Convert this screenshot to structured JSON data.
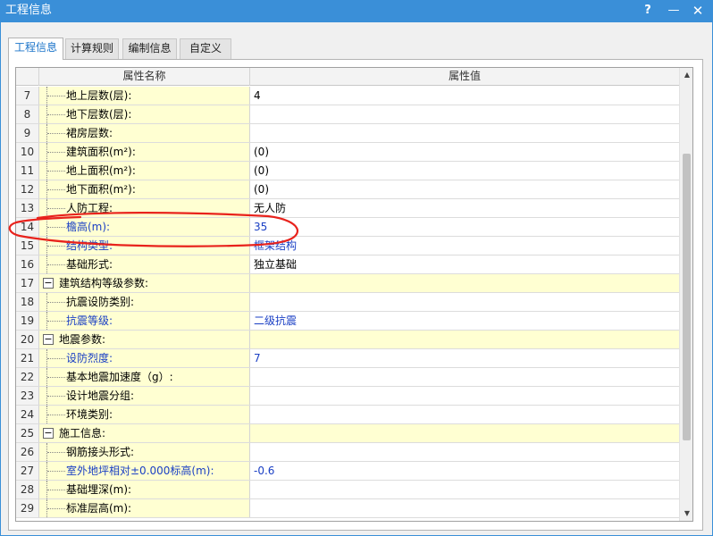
{
  "window": {
    "title": "工程信息",
    "help_label": "?",
    "minimize_label": "—",
    "close_label": "✕"
  },
  "tabs": [
    {
      "label": "工程信息",
      "active": true
    },
    {
      "label": "计算规则",
      "active": false
    },
    {
      "label": "编制信息",
      "active": false
    },
    {
      "label": "自定义",
      "active": false
    }
  ],
  "grid": {
    "columns": {
      "name": "属性名称",
      "value": "属性值"
    },
    "rows": [
      {
        "index": "7",
        "name": "地上层数(层):",
        "value": "4",
        "group": false,
        "blue": false
      },
      {
        "index": "8",
        "name": "地下层数(层):",
        "value": "",
        "group": false,
        "blue": false
      },
      {
        "index": "9",
        "name": "裙房层数:",
        "value": "",
        "group": false,
        "blue": false
      },
      {
        "index": "10",
        "name": "建筑面积(m²):",
        "value": "(0)",
        "group": false,
        "blue": false
      },
      {
        "index": "11",
        "name": "地上面积(m²):",
        "value": "(0)",
        "group": false,
        "blue": false
      },
      {
        "index": "12",
        "name": "地下面积(m²):",
        "value": "(0)",
        "group": false,
        "blue": false
      },
      {
        "index": "13",
        "name": "人防工程:",
        "value": "无人防",
        "group": false,
        "blue": false
      },
      {
        "index": "14",
        "name": "檐高(m):",
        "value": "35",
        "group": false,
        "blue": true
      },
      {
        "index": "15",
        "name": "结构类型:",
        "value": "框架结构",
        "group": false,
        "blue": true
      },
      {
        "index": "16",
        "name": "基础形式:",
        "value": "独立基础",
        "group": false,
        "blue": false
      },
      {
        "index": "17",
        "name": "建筑结构等级参数:",
        "value": "",
        "group": true,
        "blue": false
      },
      {
        "index": "18",
        "name": "抗震设防类别:",
        "value": "",
        "group": false,
        "blue": false
      },
      {
        "index": "19",
        "name": "抗震等级:",
        "value": "二级抗震",
        "group": false,
        "blue": true
      },
      {
        "index": "20",
        "name": "地震参数:",
        "value": "",
        "group": true,
        "blue": false
      },
      {
        "index": "21",
        "name": "设防烈度:",
        "value": "7",
        "group": false,
        "blue": true
      },
      {
        "index": "22",
        "name": "基本地震加速度（g）:",
        "value": "",
        "group": false,
        "blue": false
      },
      {
        "index": "23",
        "name": "设计地震分组:",
        "value": "",
        "group": false,
        "blue": false
      },
      {
        "index": "24",
        "name": "环境类别:",
        "value": "",
        "group": false,
        "blue": false
      },
      {
        "index": "25",
        "name": "施工信息:",
        "value": "",
        "group": true,
        "blue": false
      },
      {
        "index": "26",
        "name": "钢筋接头形式:",
        "value": "",
        "group": false,
        "blue": false
      },
      {
        "index": "27",
        "name": "室外地坪相对±0.000标高(m):",
        "value": "-0.6",
        "group": false,
        "blue": true
      },
      {
        "index": "28",
        "name": "基础埋深(m):",
        "value": "",
        "group": false,
        "blue": false
      },
      {
        "index": "29",
        "name": "标准层高(m):",
        "value": "",
        "group": false,
        "blue": false
      }
    ]
  },
  "colors": {
    "titlebar": "#3a8fd8",
    "name_cell": "#ffffd2",
    "modified_text": "#1a3fc4",
    "annotation": "#e8221c"
  },
  "icons": {
    "collapse": "minus-box-icon",
    "scroll_up": "triangle-up-icon",
    "scroll_down": "triangle-down-icon"
  },
  "symbols": {
    "collapse": "−",
    "scroll_up": "▲",
    "scroll_down": "▼"
  }
}
